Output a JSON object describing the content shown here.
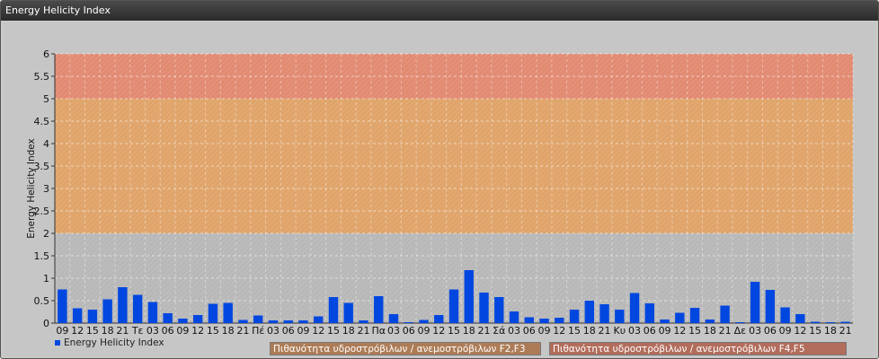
{
  "window": {
    "title": "Energy Helicity Index"
  },
  "legend": {
    "series_label": "Energy Helicity Index",
    "band_f2f3": "Πιθανότητα υδροστρόβιλων / ανεμοστρόβιλων F2,F3",
    "band_f4f5": "Πιθανότητα υδροστρόβιλων / ανεμοστρόβιλων F4,F5"
  },
  "colors": {
    "bar": "#0047e0",
    "band_low": "#b8b8b8",
    "band_mid": "#e0a46a",
    "band_high": "#e28a72",
    "plot_bg": "#c6c6c6"
  },
  "chart_data": {
    "type": "bar",
    "ylabel": "Energy Helicity Index",
    "xlabel": "",
    "ylim": [
      0,
      6
    ],
    "yticks": [
      "0",
      "0.5",
      "1",
      "1.5",
      "2",
      "2.5",
      "3",
      "3.5",
      "4",
      "4.5",
      "5",
      "5.5",
      "6"
    ],
    "grid": true,
    "bands": [
      {
        "from": 0,
        "to": 2,
        "label": ""
      },
      {
        "from": 2,
        "to": 5,
        "label": "Πιθανότητα υδροστρόβιλων / ανεμοστρόβιλων F2,F3"
      },
      {
        "from": 5,
        "to": 6,
        "label": "Πιθανότητα υδροστρόβιλων / ανεμοστρόβιλων F4,F5"
      }
    ],
    "categories": [
      "09",
      "12",
      "15",
      "18",
      "21",
      "Τε",
      "03",
      "06",
      "09",
      "12",
      "15",
      "18",
      "21",
      "Πέ",
      "03",
      "06",
      "09",
      "12",
      "15",
      "18",
      "21",
      "Πα",
      "03",
      "06",
      "09",
      "12",
      "15",
      "18",
      "21",
      "Σά",
      "03",
      "06",
      "09",
      "12",
      "15",
      "18",
      "21",
      "Κυ",
      "03",
      "06",
      "09",
      "12",
      "15",
      "18",
      "21",
      "Δε",
      "03",
      "06",
      "09",
      "12",
      "15",
      "18",
      "21"
    ],
    "series": [
      {
        "name": "Energy Helicity Index",
        "values": [
          0.75,
          0.33,
          0.3,
          0.53,
          0.8,
          0.63,
          0.47,
          0.22,
          0.1,
          0.18,
          0.43,
          0.45,
          0.07,
          0.17,
          0.06,
          0.06,
          0.06,
          0.15,
          0.58,
          0.45,
          0.06,
          0.6,
          0.2,
          0.02,
          0.07,
          0.18,
          0.75,
          1.18,
          0.68,
          0.58,
          0.26,
          0.13,
          0.1,
          0.12,
          0.3,
          0.5,
          0.42,
          0.3,
          0.67,
          0.44,
          0.08,
          0.23,
          0.34,
          0.08,
          0.39,
          0.02,
          0.92,
          0.74,
          0.35,
          0.2,
          0.03,
          0.02,
          0.03
        ]
      }
    ]
  }
}
